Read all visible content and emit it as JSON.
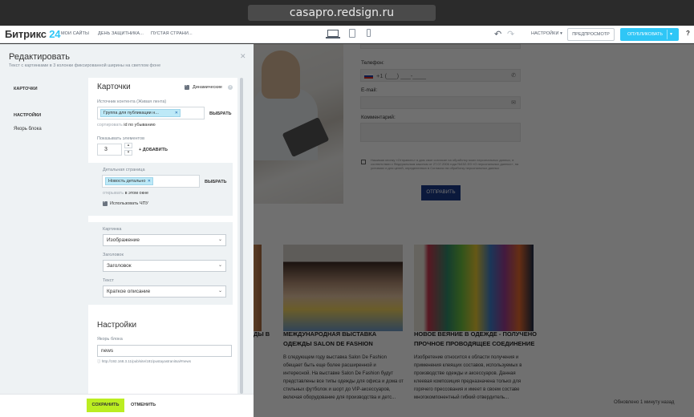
{
  "browser": {
    "url": "casapro.redsign.ru"
  },
  "topbar": {
    "logo_text": "Битрикс",
    "logo_num": "24",
    "nav": [
      "МОИ САЙТЫ",
      "ДЕНЬ ЗАЩИТНИКА...",
      "ПУСТАЯ СТРАНИ..."
    ],
    "settings": "НАСТРОЙКИ",
    "preview": "ПРЕДПРОСМОТР",
    "publish": "ОПУБЛИКОВАТЬ",
    "help": "?"
  },
  "panel": {
    "title": "Редактировать",
    "subtitle": "Текст с картинками в 3 колонки фиксированной ширины на светлом фоне",
    "sidebar": {
      "items": [
        "КАРТОЧКИ",
        "НАСТРОЙКИ",
        "Якорь блока"
      ]
    },
    "cards": {
      "title": "Карточки",
      "dynamic_label": "Динамические",
      "source_label": "Источник контента (Живая лента)",
      "source_tag": "Группа для публикации н...",
      "choose": "ВЫБРАТЬ",
      "sort_muted": "сортировать",
      "sort_field": "id",
      "sort_order": "по убыванию",
      "show_label": "Показывать элементов",
      "show_value": "3",
      "add": "ДОБАВИТЬ",
      "detail_label": "Детальная страница",
      "detail_tag": "Новость детально",
      "detail_choose": "ВЫБРАТЬ",
      "open_muted": "открывать",
      "open_value": "в этом окне",
      "use_cpu": "Использовать ЧПУ",
      "picture_label": "Картинка",
      "picture_value": "Изображение",
      "heading_label": "Заголовок",
      "heading_value": "Заголовок",
      "text_label": "Текст",
      "text_value": "Краткое описание"
    },
    "settings": {
      "title": "Настройки",
      "anchor_label": "Якорь блока",
      "anchor_value": "news",
      "anchor_url": "http://192.168.3.11/pub/site/181/pustayastranitsa/#news"
    },
    "footer": {
      "save": "СОХРАНИТЬ",
      "cancel": "ОТМЕНИТЬ"
    }
  },
  "site": {
    "form": {
      "phone_label": "Телефон:",
      "phone_placeholder": "+1 (___) ___-____",
      "email_label": "E-mail:",
      "comment_label": "Комментарий:",
      "consent": "Нажимая кнопку «Отправить» я даю свое согласие на обработку моих персональных данных, в соответствии с Федеральным законом от 27.07.2006 года №152-ФЗ «О персональных данных», на условиях и для целей, определенных в Согласии на обработку персональных данных",
      "send": "ОТПРАВИТЬ"
    },
    "cards": [
      {
        "title": "ДЫ В",
        "text": ""
      },
      {
        "title": "МЕЖДУНАРОДНАЯ ВЫСТАВКА ОДЕЖДЫ SALON DE FASHION",
        "text": "В следующем году выставка Salon De Fashion обещает быть еще более расширенной и интересной. На выставке Salon De Fashion будут представлены все типы одежды для офиса и дома от стильных футболок и шорт до VIP-аксессуаров, включая оборудование для производства и детс..."
      },
      {
        "title": "НОВОЕ ВЕЯНИЕ В ОДЕЖДЕ - ПОЛУЧЕНО ПРОЧНОЕ ПРОВОДЯЩЕЕ СОЕДИНЕНИЕ",
        "text": "Изобретение относится к области получения и применения клеящих составов, используемых в производстве одежды и аксессуаров. Данная клеевая композиция предназначена только для горячего прессования и имеет в своем составе многокомпонентный гибкий отвердитель..."
      }
    ],
    "status": "Обновлено 1 минуту назад"
  }
}
